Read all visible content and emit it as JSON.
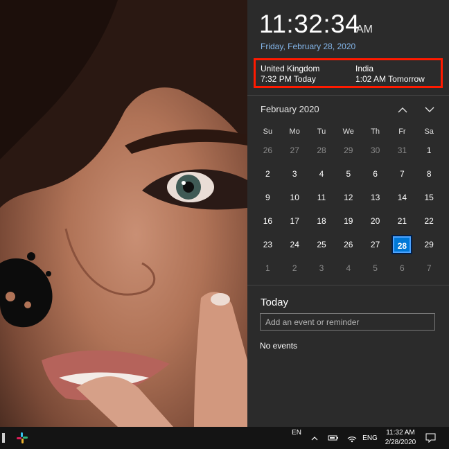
{
  "flyout": {
    "time": "11:32:34",
    "ampm": "AM",
    "date": "Friday, February 28, 2020",
    "time_zones": [
      {
        "name": "United Kingdom",
        "time": "7:32 PM Today"
      },
      {
        "name": "India",
        "time": "1:02 AM Tomorrow"
      }
    ],
    "calendar": {
      "month": "February 2020",
      "weekdays": [
        "Su",
        "Mo",
        "Tu",
        "We",
        "Th",
        "Fr",
        "Sa"
      ],
      "weeks": [
        [
          "26",
          "27",
          "28",
          "29",
          "30",
          "31",
          "1"
        ],
        [
          "2",
          "3",
          "4",
          "5",
          "6",
          "7",
          "8"
        ],
        [
          "9",
          "10",
          "11",
          "12",
          "13",
          "14",
          "15"
        ],
        [
          "16",
          "17",
          "18",
          "19",
          "20",
          "21",
          "22"
        ],
        [
          "23",
          "24",
          "25",
          "26",
          "27",
          "28",
          "29"
        ],
        [
          "1",
          "2",
          "3",
          "4",
          "5",
          "6",
          "7"
        ]
      ],
      "selected_day": "28"
    },
    "agenda": {
      "title": "Today",
      "input_placeholder": "Add an event or reminder",
      "empty_text": "No events"
    }
  },
  "taskbar": {
    "input_indicator": "EN",
    "language": "ENG",
    "clock_time": "11:32 AM",
    "clock_date": "2/28/2020"
  },
  "colors": {
    "panel_bg": "#2b2b2b",
    "accent": "#0078d7",
    "date_link": "#84b6ea",
    "highlight_box": "#ff1a00",
    "taskbar_bg": "#141414"
  }
}
